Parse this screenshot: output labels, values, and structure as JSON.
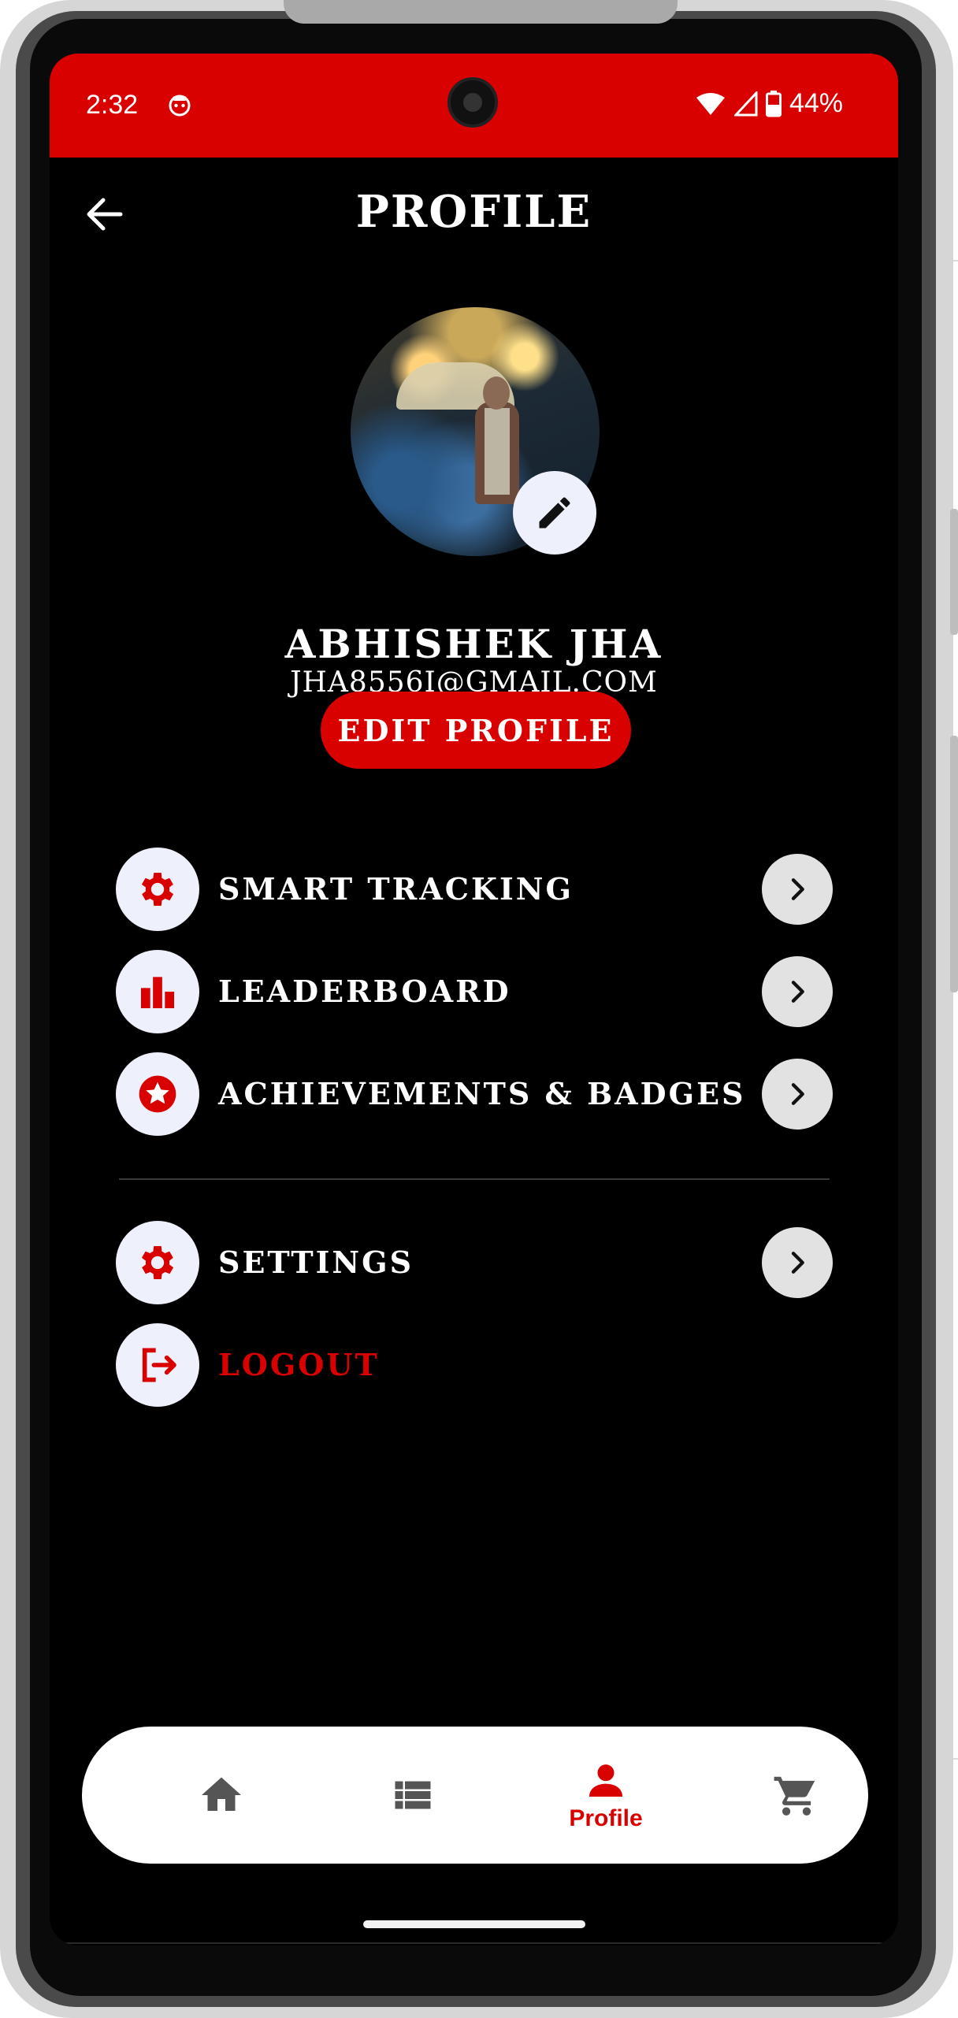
{
  "status_bar": {
    "time": "2:32",
    "battery": "44%"
  },
  "header": {
    "title": "PROFILE"
  },
  "profile": {
    "name": "ABHISHEK JHA",
    "email": "JHA8556I@GMAIL.COM",
    "edit_button": "EDIT PROFILE"
  },
  "menu": {
    "smart_tracking": "SMART TRACKING",
    "leaderboard": "LEADERBOARD",
    "achievements": "ACHIEVEMENTS & BADGES",
    "settings": "SETTINGS",
    "logout": "LOGOUT"
  },
  "bottom_nav": {
    "active_label": "Profile",
    "items": [
      "home-icon",
      "list-icon",
      "person-icon",
      "cart-icon"
    ]
  },
  "colors": {
    "accent": "#d90000",
    "icon_bg": "#eef0fb",
    "chevron_bg": "#e2e2e2"
  }
}
